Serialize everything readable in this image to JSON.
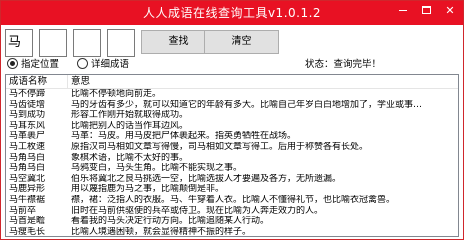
{
  "window": {
    "title": "人人成语在线查询工具v1.0.1.2"
  },
  "title_buttons": {
    "minimize": "",
    "maximize": "",
    "close": "✕"
  },
  "search": {
    "char_inputs": [
      "马",
      "",
      "",
      ""
    ],
    "search_label": "查找",
    "clear_label": "清空"
  },
  "options": {
    "radio_position": "指定位置",
    "radio_detailed": "详细成语",
    "selected": "指定位置"
  },
  "status": {
    "label": "状态：",
    "value": "查询完毕！"
  },
  "table": {
    "columns": [
      "成语名称",
      "意思"
    ],
    "rows": [
      [
        "马不停蹄",
        "比喻不停顿地向前走。"
      ],
      [
        "马齿徒增",
        "马的牙齿有多少，就可以知道它的年龄有多大。比喻自己年岁白白地增加了，学业或事…"
      ],
      [
        "马到成功",
        "形容工作刚开始就取得成功。"
      ],
      [
        "马耳东风",
        "比喻把别人的话当作耳边风。"
      ],
      [
        "马革裹尸",
        "马革：马皮。用马皮把尸体裹起来。指英勇牺牲在战场。"
      ],
      [
        "马工枚速",
        "原指汉司马相如文章写得慢，司马相如文章写得工。后用于称赞各有长处。"
      ],
      [
        "马角乌白",
        "象棋术语，比喻不太好的事。"
      ],
      [
        "马角乌白",
        "乌鸦变白，马头生角。比喻不能实现之事。"
      ],
      [
        "马空冀北",
        "伯乐将冀北之良马挑选一空，比喻选拔人才要遍及各方，无所遗漏。"
      ],
      [
        "马鹿异形",
        "用以蔑指鹿为马之事，比喻颠倒是非。"
      ],
      [
        "马牛襟裾",
        "襟，裙：泛指人的衣服。马、牛穿着人衣。比喻人不懂得礼节，也比喻衣冠禽兽。"
      ],
      [
        "马前卒",
        "旧时在马前供驱使的兵卒或侍卫。现在比喻为人奔走效力的人。"
      ],
      [
        "马首是瞻",
        "看着我的马头决定行动方向。比喻追随某人行动。"
      ],
      [
        "马瘦毛长",
        "比喻人境遇困顿，就会显得精神不振的样子。"
      ],
      [
        "马仰人翻",
        "形容极忙乱或极乱的样子。"
      ]
    ]
  }
}
